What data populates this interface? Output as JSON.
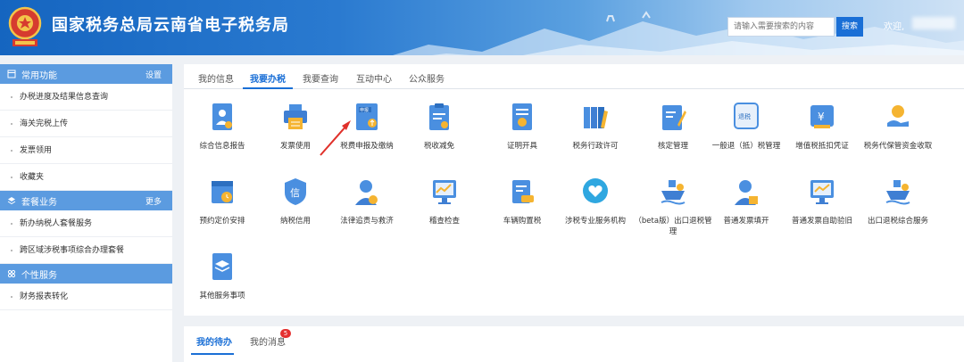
{
  "header": {
    "title": "国家税务总局云南省电子税务局",
    "search_placeholder": "请输入需要搜索的内容",
    "search_label": "搜索",
    "welcome": "欢迎,"
  },
  "sidebar": {
    "sections": [
      {
        "title": "常用功能",
        "action": "设置",
        "items": [
          "办税进度及结果信息查询",
          "海关完税上传",
          "发票领用",
          "收藏夹"
        ]
      },
      {
        "title": "套餐业务",
        "action": "更多",
        "items": [
          "新办纳税人套餐服务",
          "跨区域涉税事项综合办理套餐"
        ]
      },
      {
        "title": "个性服务",
        "action": "",
        "items": [
          "财务报表转化"
        ]
      }
    ]
  },
  "tabs": [
    "我的信息",
    "我要办税",
    "我要查询",
    "互动中心",
    "公众服务"
  ],
  "active_tab": "我要办税",
  "services": [
    {
      "label": "综合信息报告",
      "icon": "document-user-icon"
    },
    {
      "label": "发票使用",
      "icon": "printer-icon"
    },
    {
      "label": "税费申报及缴纳",
      "icon": "tax-declaration-icon"
    },
    {
      "label": "税收减免",
      "icon": "clipboard-check-icon"
    },
    {
      "label": "证明开具",
      "icon": "certificate-icon"
    },
    {
      "label": "税务行政许可",
      "icon": "folders-icon"
    },
    {
      "label": "核定管理",
      "icon": "edit-document-icon"
    },
    {
      "label": "一般退（抵）税管理",
      "icon": "tax-refund-icon"
    },
    {
      "label": "增值税抵扣凭证",
      "icon": "yen-wallet-icon"
    },
    {
      "label": "税务代保管资金收取",
      "icon": "hand-coin-icon"
    },
    {
      "label": "预约定价安排",
      "icon": "calendar-clock-icon"
    },
    {
      "label": "纳税信用",
      "icon": "credit-shield-icon"
    },
    {
      "label": "法律追责与救济",
      "icon": "legal-person-icon"
    },
    {
      "label": "稽查检查",
      "icon": "monitor-chart-icon"
    },
    {
      "label": "车辆购置税",
      "icon": "vehicle-document-icon"
    },
    {
      "label": "涉税专业服务机构",
      "icon": "heart-service-icon"
    },
    {
      "label": "（beta版）出口退税管理",
      "icon": "ship-icon"
    },
    {
      "label": "普通发票填开",
      "icon": "person-invoice-icon"
    },
    {
      "label": "普通发票自助验旧",
      "icon": "monitor-check-icon"
    },
    {
      "label": "出口退税综合服务",
      "icon": "ship-icon"
    },
    {
      "label": "其他服务事项",
      "icon": "layers-doc-icon"
    }
  ],
  "bottom_tabs": [
    "我的待办",
    "我的消息"
  ],
  "message_count": "5",
  "colors": {
    "primary": "#1a6fd6",
    "sidebar_header": "#5b9be0",
    "badge": "#e43131",
    "arrow": "#e0302a"
  }
}
